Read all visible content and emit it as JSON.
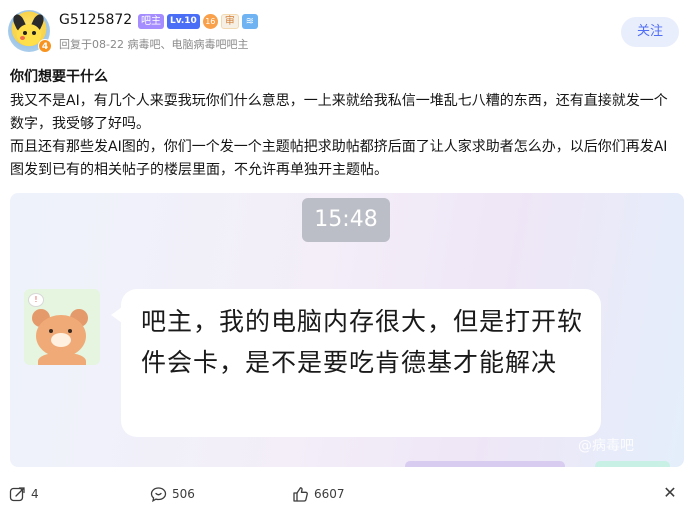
{
  "header": {
    "username": "G5125872",
    "avatar_level": "4",
    "badges": {
      "owner": "吧主",
      "level": "Lv.10",
      "circle": "16",
      "shen": "审",
      "wave": "≋"
    },
    "meta": "回复于08-22  病毒吧、电脑病毒吧吧主",
    "follow_label": "关注"
  },
  "post": {
    "title": "你们想要干什么",
    "paragraph_1": "我又不是AI，有几个人来耍我玩你们什么意思，一上来就给我私信一堆乱七八糟的东西，还有直接就发一个数字，我受够了好吗。",
    "paragraph_2": "而且还有那些发AI图的，你们一个发一个主题帖把求助帖都挤后面了让人家求助者怎么办，以后你们再发AI图发到已有的相关帖子的楼层里面，不允许再单独开主题帖。"
  },
  "image": {
    "time": "15:48",
    "message": "吧主，我的电脑内存很大，但是打开软件会卡，是不是要吃肯德基才能解决",
    "watermark": "@病毒吧"
  },
  "footer": {
    "share_count": "4",
    "comment_count": "506",
    "like_count": "6607",
    "close_symbol": "✕"
  },
  "colors": {
    "accent": "#4f6df5",
    "follow_bg": "#e9eefc",
    "owner_badge": "#a58cff",
    "level_badge": "#4a6ef5"
  }
}
